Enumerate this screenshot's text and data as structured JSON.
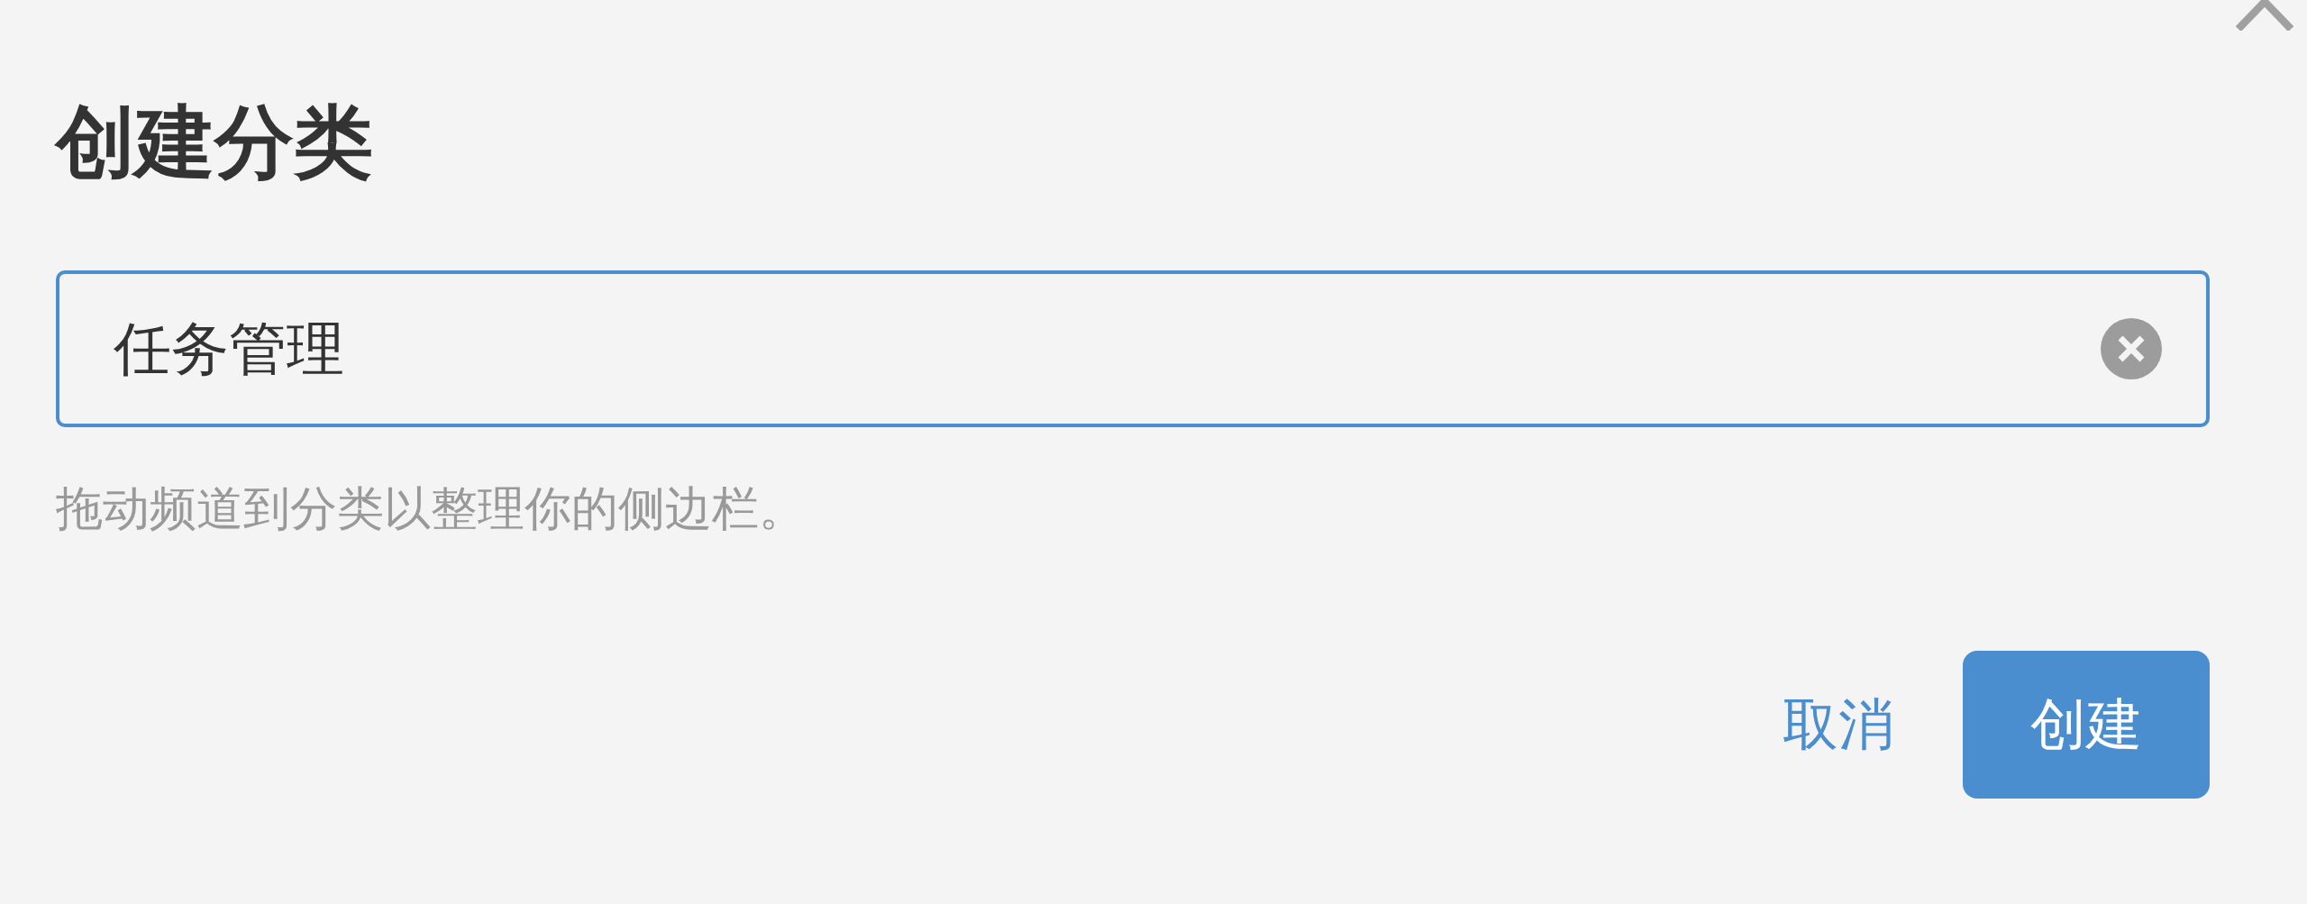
{
  "dialog": {
    "title": "创建分类"
  },
  "name_field": {
    "value": "任务管理"
  },
  "hint": "拖动频道到分类以整理你的侧边栏。",
  "buttons": [
    {
      "label": "取消",
      "kind": "link"
    },
    {
      "label": "创建",
      "kind": "primary"
    }
  ]
}
